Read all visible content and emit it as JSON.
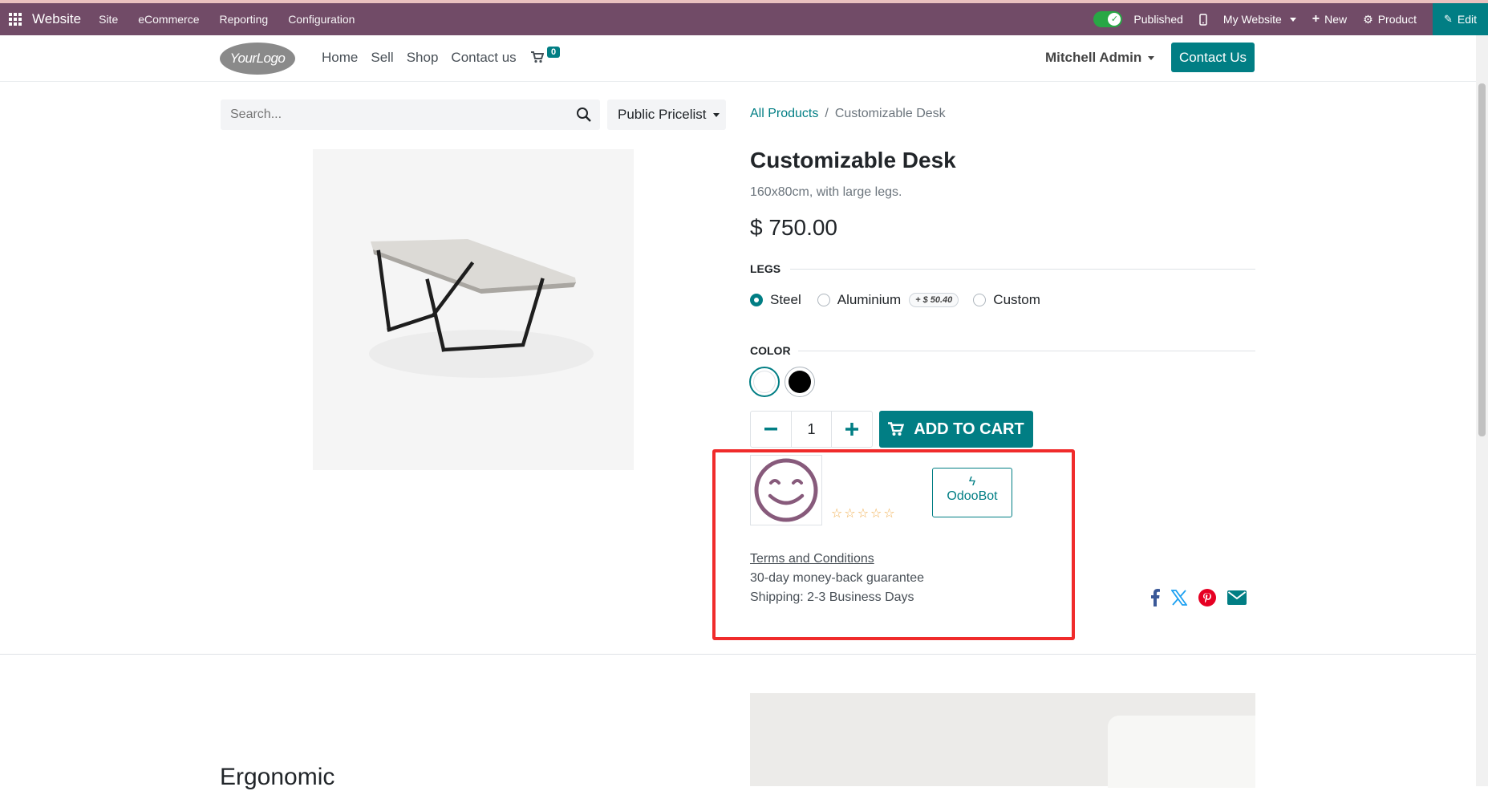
{
  "admin_bar": {
    "app_name": "Website",
    "menus": [
      "Site",
      "eCommerce",
      "Reporting",
      "Configuration"
    ],
    "published_label": "Published",
    "website_label": "My Website",
    "new_label": "New",
    "product_label": "Product",
    "edit_label": "Edit"
  },
  "navbar": {
    "logo_text": "YourLogo",
    "links": [
      "Home",
      "Sell",
      "Shop",
      "Contact us"
    ],
    "cart_count": "0",
    "user_name": "Mitchell Admin",
    "contact_button": "Contact Us"
  },
  "search": {
    "placeholder": "Search..."
  },
  "pricelist": "Public Pricelist",
  "breadcrumb": {
    "parent": "All Products",
    "current": "Customizable Desk"
  },
  "product": {
    "name": "Customizable Desk",
    "description": "160x80cm, with large legs.",
    "price": "$ 750.00",
    "legs_label": "LEGS",
    "legs_options": [
      "Steel",
      "Aluminium",
      "Custom"
    ],
    "legs_selected": "Steel",
    "aluminium_extra": "+ $ 50.40",
    "color_label": "COLOR",
    "colors": [
      "#ffffff",
      "#000000"
    ],
    "quantity": "1",
    "add_to_cart": "ADD TO CART"
  },
  "reviewer": {
    "name": "OdooBot",
    "rating_stars": "☆☆☆☆☆"
  },
  "terms": {
    "link": "Terms and Conditions",
    "guarantee": "30-day money-back guarantee",
    "shipping": "Shipping: 2-3 Business Days"
  },
  "section": {
    "heading": "Ergonomic"
  },
  "colors": {
    "brand": "#714b67",
    "accent": "#017e84",
    "highlight": "#f02b2b"
  }
}
